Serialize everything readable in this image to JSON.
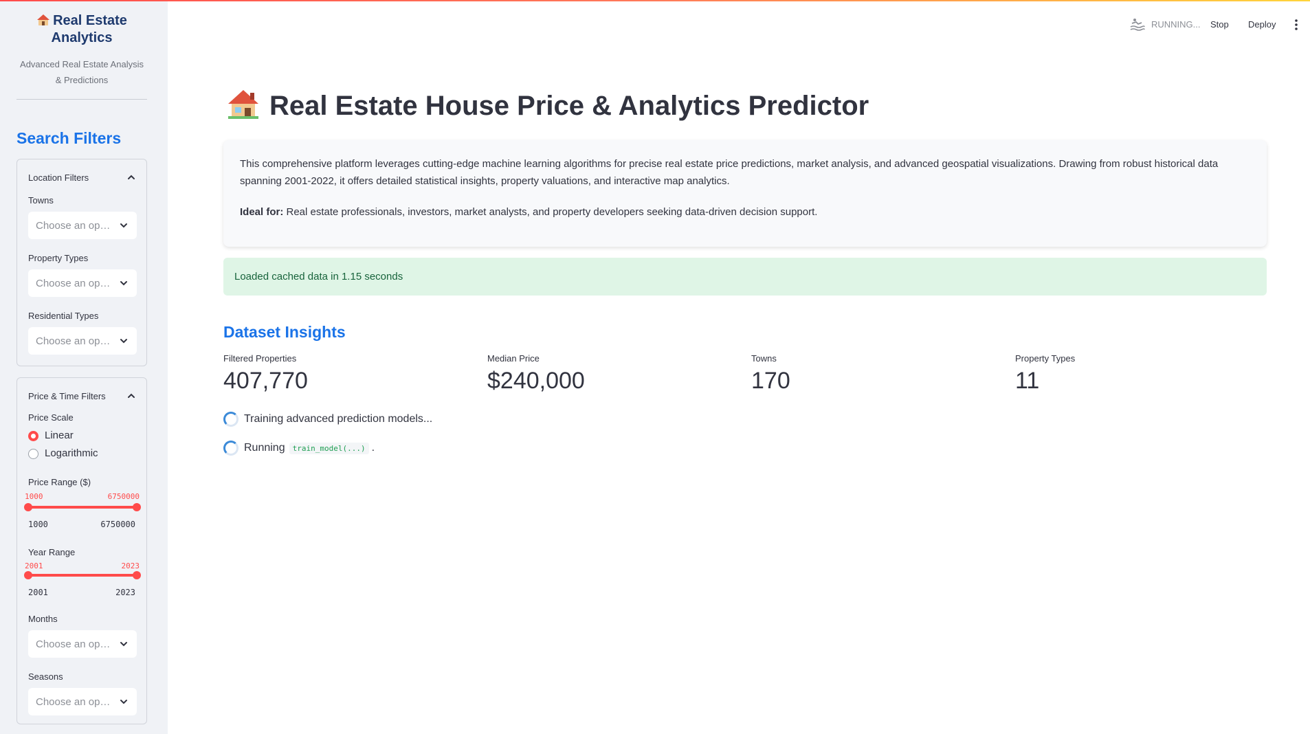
{
  "sidebar": {
    "brand_title": "Real Estate Analytics",
    "brand_subtitle": "Advanced Real Estate Analysis & Predictions",
    "search_heading": "Search Filters",
    "location": {
      "title": "Location Filters",
      "towns_label": "Towns",
      "towns_placeholder": "Choose an options",
      "property_types_label": "Property Types",
      "property_types_placeholder": "Choose an options",
      "residential_types_label": "Residential Types",
      "residential_types_placeholder": "Choose an options"
    },
    "price_time": {
      "title": "Price & Time Filters",
      "price_scale_label": "Price Scale",
      "scale_options": [
        "Linear",
        "Logarithmic"
      ],
      "scale_selected": "Linear",
      "price_range_label": "Price Range ($)",
      "price_range": {
        "low": "1000",
        "high": "6750000",
        "min": "1000",
        "max": "6750000"
      },
      "year_range_label": "Year Range",
      "year_range": {
        "low": "2001",
        "high": "2023",
        "min": "2001",
        "max": "2023"
      },
      "months_label": "Months",
      "months_placeholder": "Choose an options",
      "seasons_label": "Seasons",
      "seasons_placeholder": "Choose an options"
    }
  },
  "header": {
    "status": "RUNNING...",
    "stop": "Stop",
    "deploy": "Deploy"
  },
  "main": {
    "title": "Real Estate House Price & Analytics Predictor",
    "intro_paragraph": "This comprehensive platform leverages cutting-edge machine learning algorithms for precise real estate price predictions, market analysis, and advanced geospatial visualizations. Drawing from robust historical data spanning 2001-2022, it offers detailed statistical insights, property valuations, and interactive map analytics.",
    "ideal_for_label": "Ideal for:",
    "ideal_for_text": " Real estate professionals, investors, market analysts, and property developers seeking data-driven decision support.",
    "success_prefix": "Loaded cached data in ",
    "success_time": "1.15 seconds",
    "insights_heading": "Dataset Insights",
    "metrics": [
      {
        "label": "Filtered Properties",
        "value": "407,770"
      },
      {
        "label": "Median Price",
        "value": "$240,000"
      },
      {
        "label": "Towns",
        "value": "170"
      },
      {
        "label": "Property Types",
        "value": "11"
      }
    ],
    "status_training": "Training advanced prediction models...",
    "status_running_prefix": "Running",
    "status_running_code": "train_model(...)",
    "status_running_suffix": "."
  },
  "colors": {
    "accent": "#ff4b4b",
    "heading_blue": "#1a73e8",
    "success_bg": "#dff5e6"
  },
  "icons": [
    "house-emoji-icon",
    "chevron-up-icon",
    "chevron-down-icon",
    "running-icon",
    "kebab-menu-icon",
    "spinner-icon"
  ]
}
